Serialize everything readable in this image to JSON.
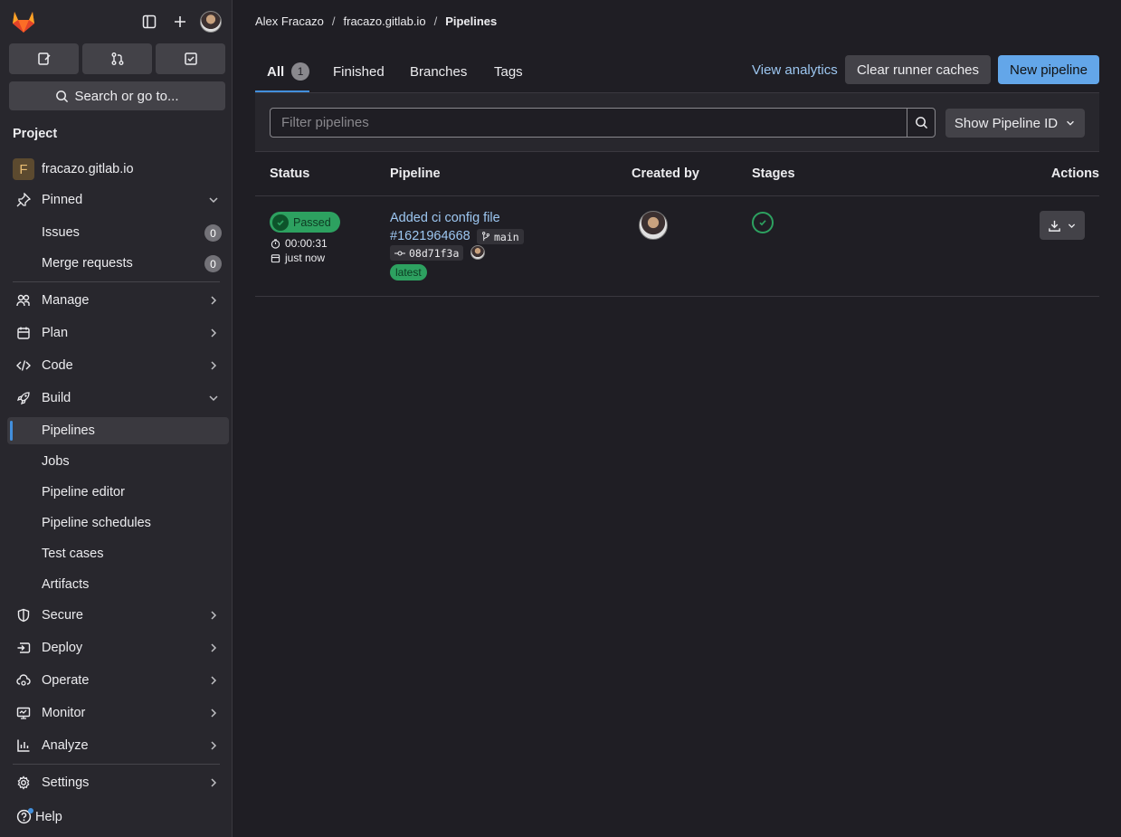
{
  "sidebar": {
    "search_label": "Search or go to...",
    "section_title": "Project",
    "project_name": "fracazo.gitlab.io",
    "project_initial": "F",
    "pinned_label": "Pinned",
    "pinned_items": [
      {
        "label": "Issues",
        "count": "0"
      },
      {
        "label": "Merge requests",
        "count": "0"
      }
    ],
    "nav": {
      "manage": "Manage",
      "plan": "Plan",
      "code": "Code",
      "build": "Build",
      "secure": "Secure",
      "deploy": "Deploy",
      "operate": "Operate",
      "monitor": "Monitor",
      "analyze": "Analyze",
      "settings": "Settings"
    },
    "build_items": [
      "Pipelines",
      "Jobs",
      "Pipeline editor",
      "Pipeline schedules",
      "Test cases",
      "Artifacts"
    ],
    "help_label": "Help"
  },
  "breadcrumb": [
    "Alex Fracazo",
    "fracazo.gitlab.io",
    "Pipelines"
  ],
  "tabs": [
    {
      "label": "All",
      "count": "1"
    },
    {
      "label": "Finished"
    },
    {
      "label": "Branches"
    },
    {
      "label": "Tags"
    }
  ],
  "actions": {
    "view_analytics": "View analytics",
    "clear_caches": "Clear runner caches",
    "new_pipeline": "New pipeline"
  },
  "filter": {
    "placeholder": "Filter pipelines",
    "show_id": "Show Pipeline ID"
  },
  "table": {
    "headers": [
      "Status",
      "Pipeline",
      "Created by",
      "Stages",
      "Actions"
    ],
    "rows": [
      {
        "status": "Passed",
        "duration": "00:00:31",
        "finished": "just now",
        "title": "Added ci config file",
        "id": "#1621964668",
        "branch": "main",
        "commit": "08d71f3a",
        "tag": "latest"
      }
    ]
  },
  "colors": {
    "accent": "#428fdc",
    "success": "#2da160",
    "link": "#9dc7f1"
  }
}
